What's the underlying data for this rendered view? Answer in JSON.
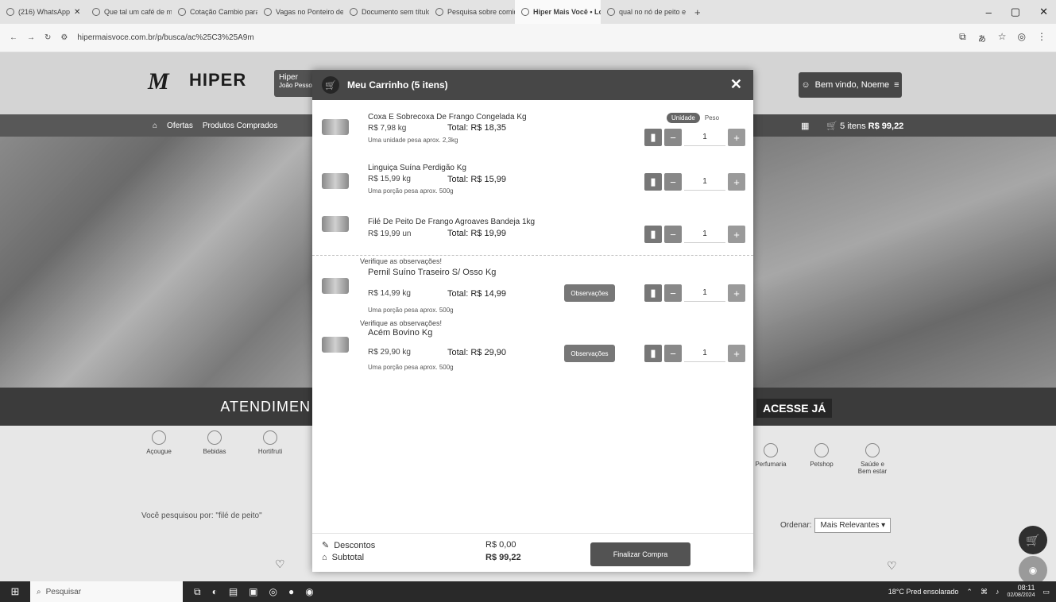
{
  "browser": {
    "tabs": [
      {
        "label": "(216) WhatsApp",
        "active": false
      },
      {
        "label": "Que tal um café de man",
        "active": false
      },
      {
        "label": "Cotação Cambio para R...",
        "active": false
      },
      {
        "label": "Vagas no Ponteiro de ...",
        "active": false
      },
      {
        "label": "Documento sem título",
        "active": false
      },
      {
        "label": "Pesquisa sobre comida",
        "active": false
      },
      {
        "label": "Hiper Mais Você • Loja I...",
        "active": true
      },
      {
        "label": "qual no nó de peito e ...",
        "active": false
      }
    ],
    "new_tab": "+",
    "window_controls": {
      "minimize": "–",
      "maximize": "▢",
      "close": "✕"
    },
    "url": "hipermaisvoce.com.br/p/busca/ac%25C3%25A9m",
    "nav": {
      "back": "←",
      "forward": "→",
      "reload": "↻"
    }
  },
  "site": {
    "logo": "M",
    "brand": "HIPER",
    "location_label": "Hiper",
    "location_sub": "João Pessoa",
    "welcome": "Bem vindo, Noeme",
    "nav_left": [
      "Ofertas",
      "Produtos Comprados"
    ],
    "cart_summary": "5 itens",
    "cart_total": "R$ 99,22",
    "banner_left_text": "ATENDIMEN",
    "banner_right_text": "ACESSE JÁ",
    "categories_left": [
      "Açougue",
      "Bebidas",
      "Hortifruti"
    ],
    "categories_right": [
      "Perfumaria",
      "Petshop",
      "Saúde e Bem estar"
    ],
    "searched_text": "Você pesquisou por: \"filé de peito\"",
    "ordenar_label": "Ordenar:",
    "ordenar_value": "Mais Relevantes ▾"
  },
  "cart": {
    "title": "Meu Carrinho (5 itens)",
    "close": "✕",
    "unit_toggle": {
      "on": "Unidade",
      "off": "Peso"
    },
    "items": [
      {
        "name": "Coxa E Sobrecoxa De Frango Congelada Kg",
        "price": "R$ 7,98 kg",
        "total": "Total: R$ 18,35",
        "note": "Uma unidade pesa aprox. 2,3kg",
        "qty": "1",
        "verify": "",
        "has_obs": false
      },
      {
        "name": "Linguiça Suína Perdigão Kg",
        "price": "R$ 15,99 kg",
        "total": "Total: R$ 15,99",
        "note": "Uma porção pesa aprox. 500g",
        "qty": "1",
        "verify": "",
        "has_obs": false
      },
      {
        "name": "Filé De Peito De Frango Agroaves Bandeja 1kg",
        "price": "R$ 19,99 un",
        "total": "Total: R$ 19,99",
        "note": "",
        "qty": "1",
        "verify": "",
        "has_obs": false
      },
      {
        "name": "Pernil Suíno Traseiro S/ Osso Kg",
        "price": "R$ 14,99 kg",
        "total": "Total: R$ 14,99",
        "note": "Uma porção pesa aprox. 500g",
        "qty": "1",
        "verify": "Verifique as observações!",
        "has_obs": true,
        "obs_label": "Observações"
      },
      {
        "name": "Acém Bovino Kg",
        "price": "R$ 29,90 kg",
        "total": "Total: R$ 29,90",
        "note": "Uma porção pesa aprox. 500g",
        "qty": "1",
        "verify": "Verifique as observações!",
        "has_obs": true,
        "obs_label": "Observações"
      }
    ],
    "footer": {
      "discount_label": "Descontos",
      "discount_value": "R$ 0,00",
      "subtotal_label": "Subtotal",
      "subtotal_value": "R$ 99,22",
      "finish_label": "Finalizar Compra"
    }
  },
  "taskbar": {
    "search_placeholder": "Pesquisar",
    "weather": "18°C  Pred ensolarado",
    "time": "08:11",
    "date": "02/08/2024"
  }
}
